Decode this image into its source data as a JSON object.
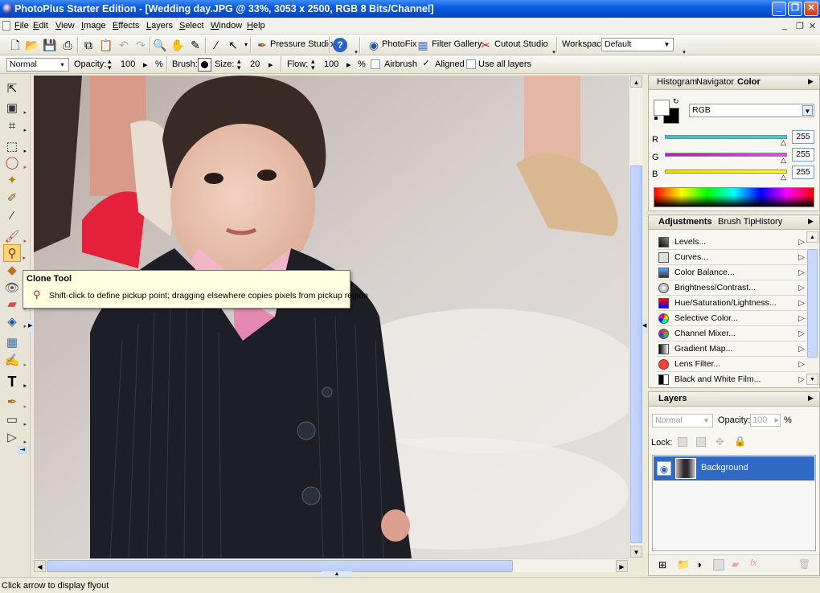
{
  "window": {
    "title": "PhotoPlus Starter Edition - [Wedding day.JPG @ 33%, 3053 x 2500, RGB 8 Bits/Channel]",
    "minimize": "_",
    "maximize": "❐",
    "close": "✕"
  },
  "menu": [
    "File",
    "Edit",
    "View",
    "Image",
    "Effects",
    "Layers",
    "Select",
    "Window",
    "Help"
  ],
  "mdi_controls": {
    "minimize": "_",
    "restore": "❐",
    "close": "✕"
  },
  "toolbar": {
    "pressure_studio": "Pressure Studio",
    "photofix": "PhotoFix",
    "filter_gallery": "Filter Gallery",
    "cutout_studio": "Cutout Studio",
    "workspace_label": "Workspace",
    "workspace_value": "Default"
  },
  "context_bar": {
    "blend_mode": "Normal",
    "opacity_label": "Opacity:",
    "opacity_value": "100",
    "percent": "%",
    "brush_label": "Brush:",
    "size_label": "Size:",
    "size_value": "20",
    "flow_label": "Flow:",
    "flow_value": "100",
    "airbrush_label": "Airbrush",
    "airbrush_checked": false,
    "aligned_label": "Aligned",
    "aligned_checked": true,
    "use_all_layers_label": "Use all layers",
    "use_all_layers_checked": false
  },
  "tooltip": {
    "title": "Clone Tool",
    "text": "Shift-click to define pickup point; dragging elsewhere copies pixels from pickup region"
  },
  "color_panel": {
    "tabs": [
      "Histogram",
      "Navigator",
      "Color"
    ],
    "active_tab": "Color",
    "mode": "RGB",
    "channels": [
      {
        "label": "R",
        "value": "255",
        "color": "#00d8e0"
      },
      {
        "label": "G",
        "value": "255",
        "color": "#e000d8"
      },
      {
        "label": "B",
        "value": "255",
        "color": "#e8e000"
      }
    ]
  },
  "adjustments_panel": {
    "tabs": [
      "Adjustments",
      "Brush Tip",
      "History"
    ],
    "active_tab": "Adjustments",
    "items": [
      "Levels...",
      "Curves...",
      "Color Balance...",
      "Brightness/Contrast...",
      "Hue/Saturation/Lightness...",
      "Selective Color...",
      "Channel Mixer...",
      "Gradient Map...",
      "Lens Filter...",
      "Black and White Film..."
    ]
  },
  "layers_panel": {
    "title": "Layers",
    "blend_mode": "Normal",
    "opacity_label": "Opacity:",
    "opacity_value": "100",
    "percent": "%",
    "lock_label": "Lock:",
    "layers": [
      {
        "name": "Background",
        "selected": true,
        "visible": true
      }
    ]
  },
  "status": {
    "text": "Click arrow to display flyout"
  },
  "colors": {
    "title_bar": "#0a5be0",
    "selection": "#316ac5",
    "tooltip_bg": "#ffffe1"
  }
}
